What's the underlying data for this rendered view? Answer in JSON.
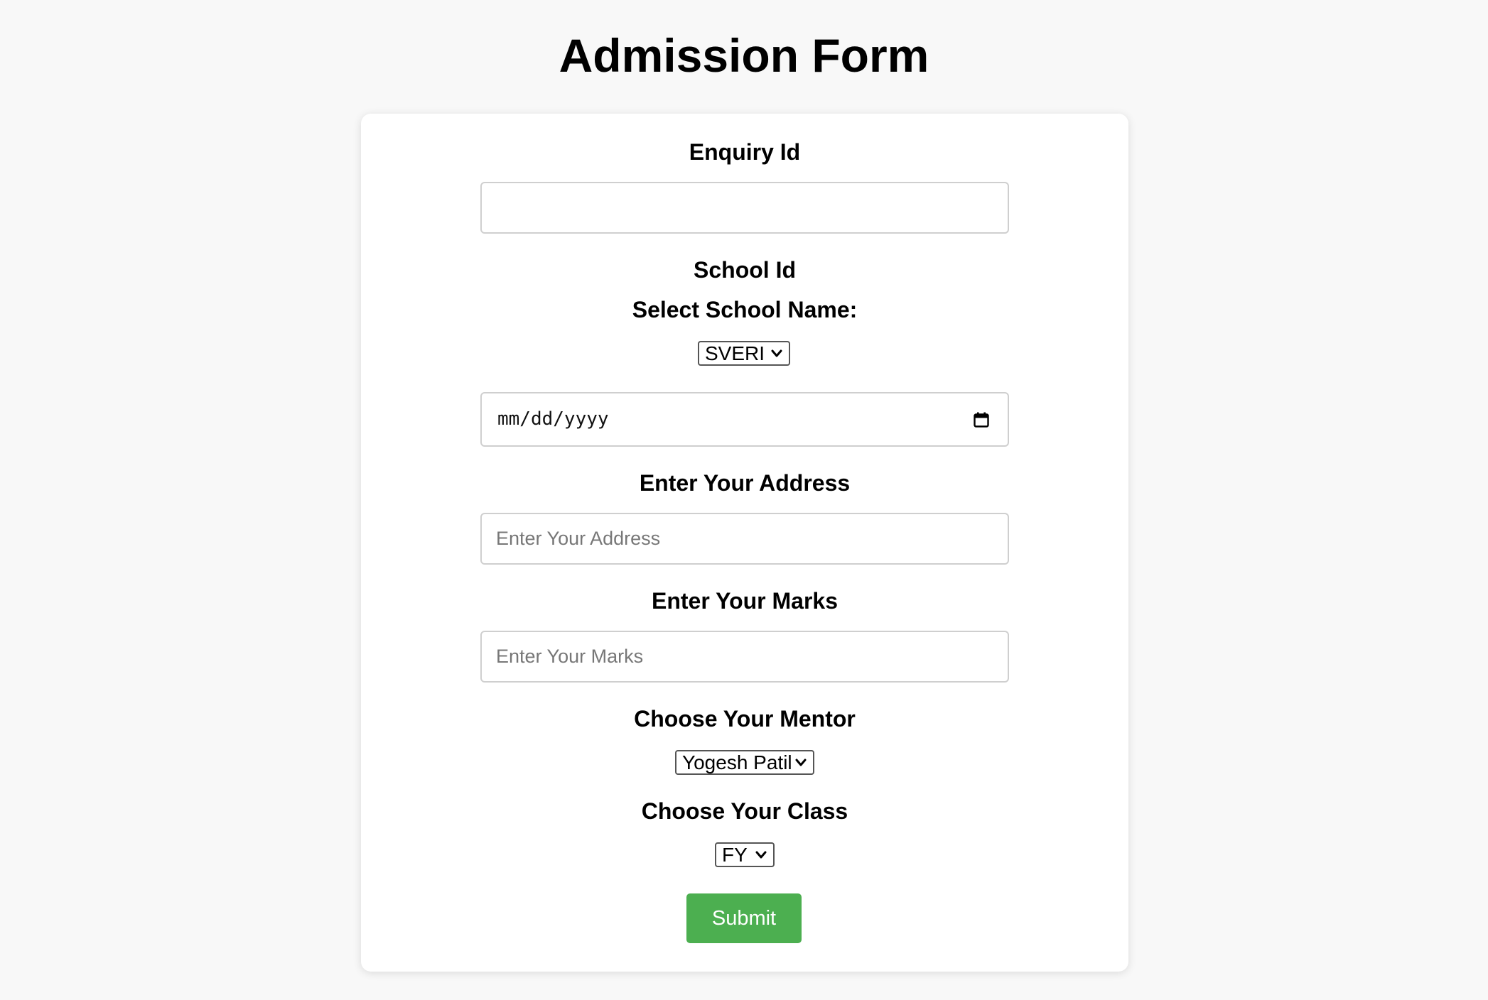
{
  "page": {
    "title": "Admission Form"
  },
  "form": {
    "enquiry_label": "Enquiry Id",
    "enquiry_value": "",
    "school_id_label": "School Id",
    "school_name_label": "Select School Name:",
    "school_selected": "SVERI",
    "date_placeholder": "mm/dd/yyyy",
    "address_label": "Enter Your Address",
    "address_placeholder": "Enter Your Address",
    "marks_label": "Enter Your Marks",
    "marks_placeholder": "Enter Your Marks",
    "mentor_label": "Choose Your Mentor",
    "mentor_selected": "Yogesh Patil",
    "class_label": "Choose Your Class",
    "class_selected": "FY",
    "submit_label": "Submit"
  },
  "colors": {
    "page_background": "#f8f8f8",
    "card_background": "#ffffff",
    "submit_button": "#4caf50"
  },
  "icons": {
    "date_picker": "calendar-icon",
    "select_toggle": "chevron-down-icon"
  }
}
